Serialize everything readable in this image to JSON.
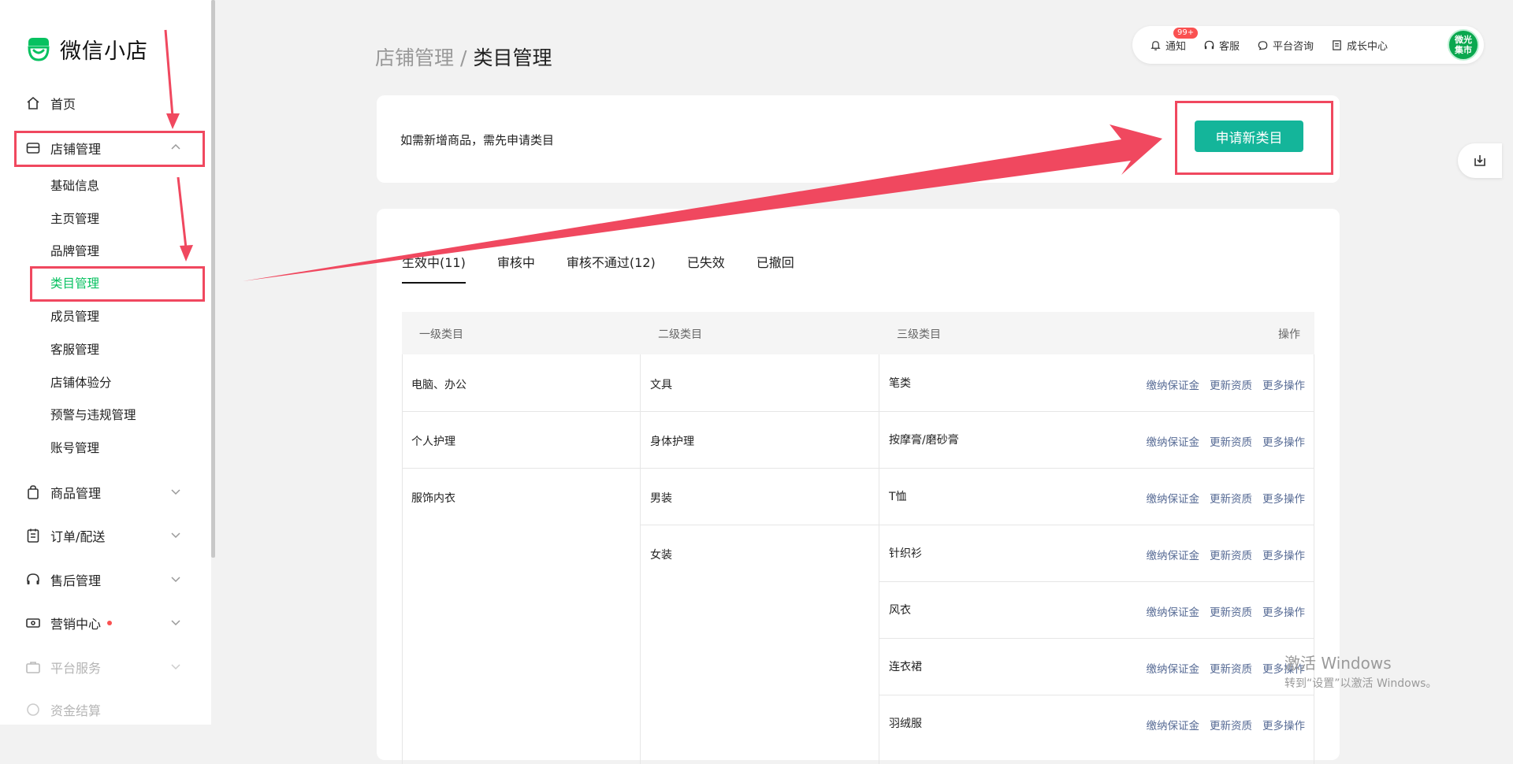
{
  "app": {
    "logo_text": "微信小店"
  },
  "sidebar": {
    "home": "首页",
    "shop_manage": "店铺管理",
    "sub_items": [
      "基础信息",
      "主页管理",
      "品牌管理",
      "类目管理",
      "成员管理",
      "客服管理",
      "店铺体验分",
      "预警与违规管理",
      "账号管理"
    ],
    "goods_manage": "商品管理",
    "order_delivery": "订单/配送",
    "after_sales": "售后管理",
    "marketing": "营销中心",
    "platform_service": "平台服务",
    "funds": "资金结算"
  },
  "header": {
    "breadcrumb_parent": "店铺管理",
    "breadcrumb_sep": "/",
    "breadcrumb_current": "类目管理",
    "notify": "通知",
    "notify_badge": "99+",
    "service": "客服",
    "consult": "平台咨询",
    "growth": "成长中心",
    "avatar_line1": "微光",
    "avatar_line2": "集市"
  },
  "banner": {
    "notice": "如需新增商品，需先申请类目",
    "apply_label": "申请新类目"
  },
  "tabs": [
    "生效中(11)",
    "审核中",
    "审核不通过(12)",
    "已失效",
    "已撤回"
  ],
  "table": {
    "headers": [
      "一级类目",
      "二级类目",
      "三级类目",
      "操作"
    ],
    "rows": [
      {
        "l1": "电脑、办公",
        "l2": "文具",
        "l3": "笔类"
      },
      {
        "l1": "个人护理",
        "l2": "身体护理",
        "l3": "按摩膏/磨砂膏"
      },
      {
        "l1": "服饰内衣",
        "l2": "男装",
        "l3": "T恤"
      },
      {
        "l1": "",
        "l2": "女装",
        "l3": "针织衫"
      },
      {
        "l1": "",
        "l2": "",
        "l3": "风衣"
      },
      {
        "l1": "",
        "l2": "",
        "l3": "连衣裙"
      },
      {
        "l1": "",
        "l2": "",
        "l3": "羽绒服"
      }
    ],
    "ops": [
      "缴纳保证金",
      "更新资质",
      "更多操作"
    ]
  },
  "windows": {
    "line1": "激活 Windows",
    "line2": "转到“设置”以激活 Windows。"
  },
  "colors": {
    "brand_green": "#07c160",
    "button_teal": "#14b59a",
    "annotation_red": "#f0485f",
    "link_blue": "#576b95"
  }
}
